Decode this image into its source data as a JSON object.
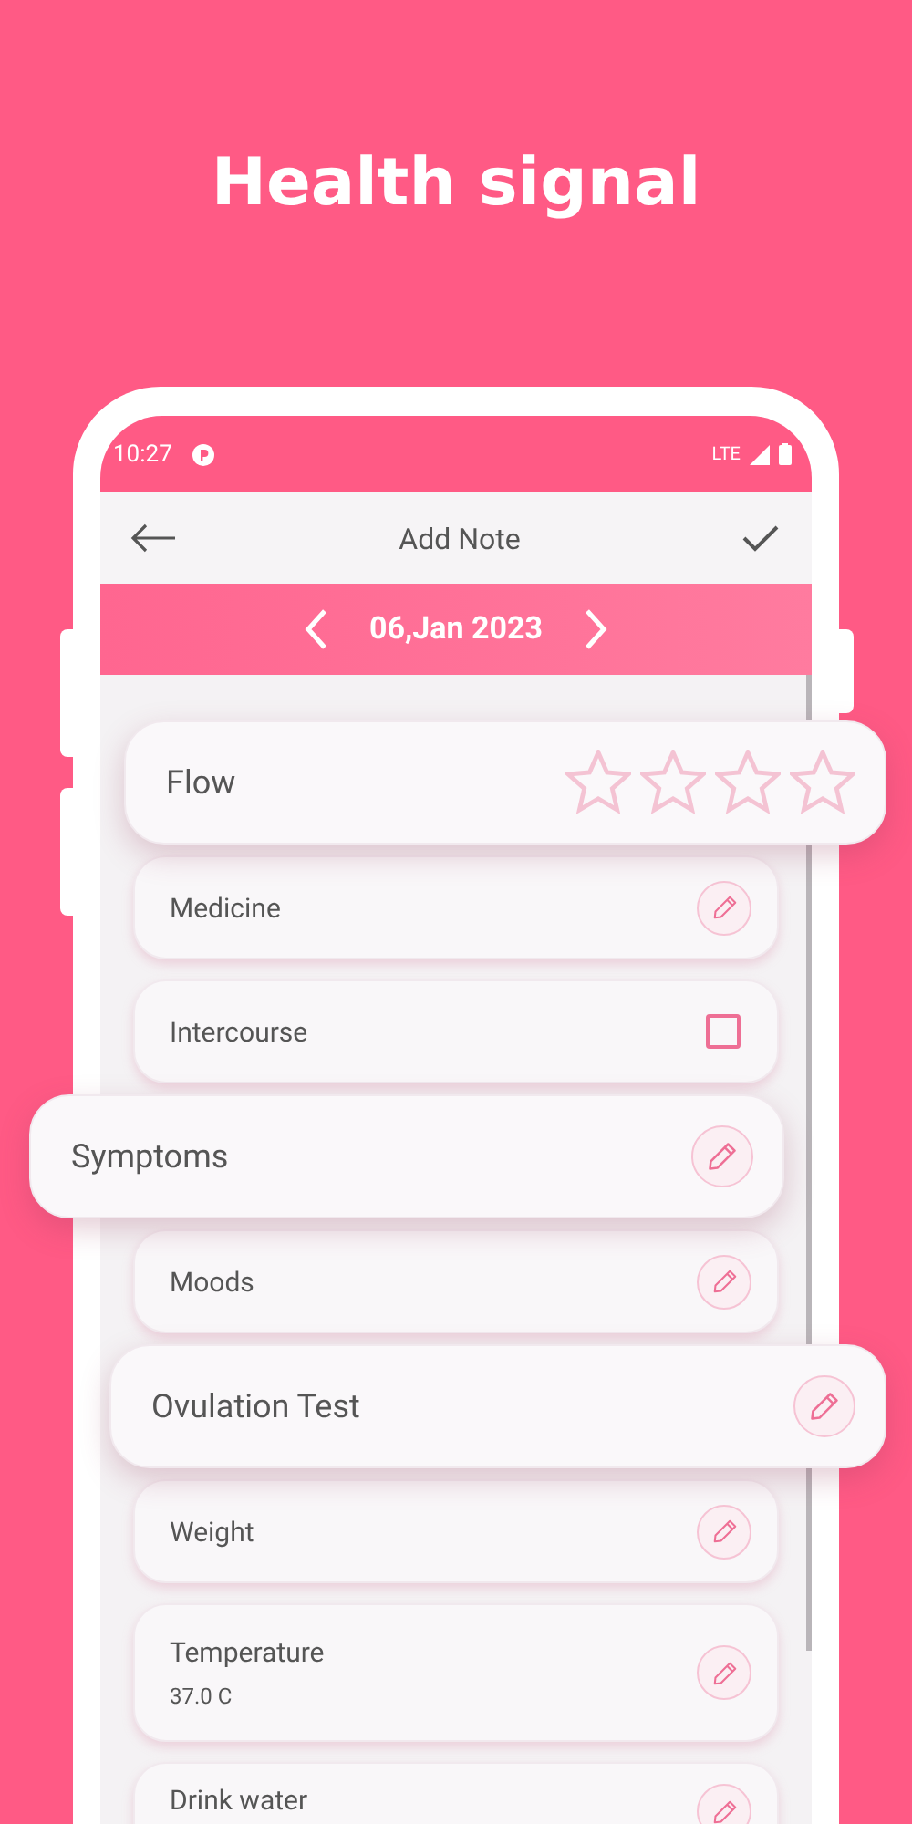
{
  "headline": "Health signal",
  "status_bar": {
    "time": "10:27",
    "network": "LTE"
  },
  "app_bar": {
    "title": "Add Note"
  },
  "date_bar": {
    "date": "06,Jan 2023"
  },
  "items": [
    {
      "label": "Flow",
      "kind": "stars",
      "floating": true,
      "stars": 0
    },
    {
      "label": "Medicine",
      "kind": "edit",
      "floating": false
    },
    {
      "label": "Intercourse",
      "kind": "checkbox",
      "floating": false,
      "checked": false
    },
    {
      "label": "Symptoms",
      "kind": "edit",
      "floating": true
    },
    {
      "label": "Moods",
      "kind": "edit",
      "floating": false
    },
    {
      "label": "Ovulation Test",
      "kind": "edit",
      "floating": true
    },
    {
      "label": "Weight",
      "kind": "edit",
      "floating": false
    },
    {
      "label": "Temperature",
      "kind": "edit",
      "floating": false,
      "value": "37.0 C"
    },
    {
      "label": "Drink water",
      "kind": "edit",
      "floating": false
    }
  ]
}
